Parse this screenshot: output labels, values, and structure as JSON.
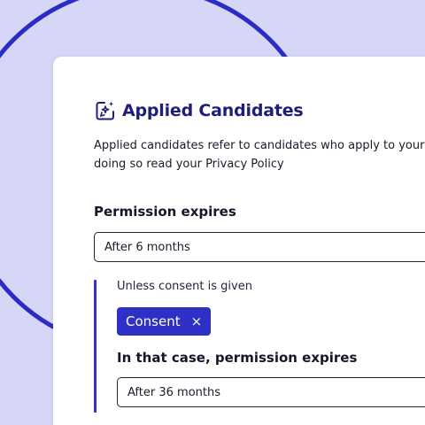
{
  "colors": {
    "background": "#d6d6f6",
    "accent": "#2f30c6",
    "title": "#1e1e78",
    "card": "#ffffff"
  },
  "header": {
    "icon": "sparkle-edit-icon",
    "title": "Applied Candidates"
  },
  "description": {
    "line1": "Applied candidates refer to candidates who apply to your v",
    "line2": "doing so read your Privacy Policy"
  },
  "permission": {
    "label": "Permission expires",
    "selected": "After 6 months"
  },
  "condition": {
    "label": "Unless consent is given",
    "chip_label": "Consent",
    "chip_remove_glyph": "×",
    "then_label": "In that case, permission expires",
    "then_selected": "After 36 months"
  }
}
